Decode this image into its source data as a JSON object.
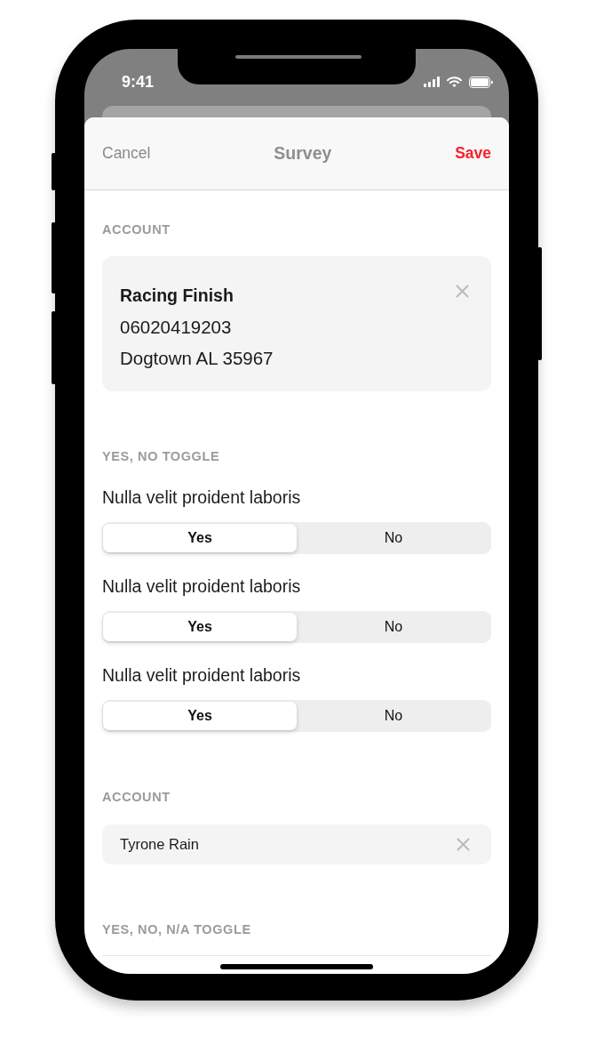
{
  "status_bar": {
    "time": "9:41"
  },
  "nav_bar": {
    "cancel": "Cancel",
    "title": "Survey",
    "save": "Save"
  },
  "sections": [
    {
      "kind": "account_card",
      "header": "ACCOUNT",
      "account": {
        "name": "Racing Finish",
        "number": "06020419203",
        "address": "Dogtown AL 35967"
      }
    },
    {
      "kind": "yes_no",
      "header": "YES, NO TOGGLE",
      "questions": [
        {
          "label": "Nulla velit proident laboris",
          "options": [
            {
              "label": "Yes",
              "selected": true
            },
            {
              "label": "No",
              "selected": false
            }
          ]
        },
        {
          "label": "Nulla velit proident laboris",
          "options": [
            {
              "label": "Yes",
              "selected": true
            },
            {
              "label": "No",
              "selected": false
            }
          ]
        },
        {
          "label": "Nulla velit proident laboris",
          "options": [
            {
              "label": "Yes",
              "selected": true
            },
            {
              "label": "No",
              "selected": false
            }
          ]
        }
      ]
    },
    {
      "kind": "account_field",
      "header": "ACCOUNT",
      "value": "Tyrone Rain"
    },
    {
      "kind": "yes_no",
      "header": "YES, NO, N/A TOGGLE"
    }
  ]
}
